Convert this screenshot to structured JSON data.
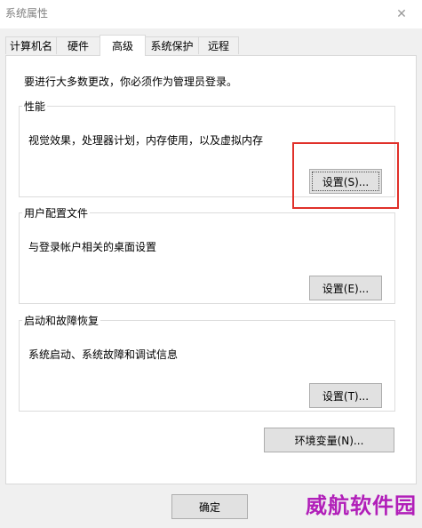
{
  "window": {
    "title": "系统属性",
    "close_glyph": "✕"
  },
  "tabs": [
    {
      "label": "计算机名"
    },
    {
      "label": "硬件"
    },
    {
      "label": "高级",
      "active": true
    },
    {
      "label": "系统保护"
    },
    {
      "label": "远程"
    }
  ],
  "admin_note": "要进行大多数更改，你必须作为管理员登录。",
  "performance": {
    "legend": "性能",
    "description": "视觉效果，处理器计划，内存使用，以及虚拟内存",
    "button": "设置(S)..."
  },
  "user_profiles": {
    "legend": "用户配置文件",
    "description": "与登录帐户相关的桌面设置",
    "button": "设置(E)..."
  },
  "startup_recovery": {
    "legend": "启动和故障恢复",
    "description": "系统启动、系统故障和调试信息",
    "button": "设置(T)..."
  },
  "env_button": "环境变量(N)...",
  "ok_button": "确定",
  "watermark": "威航软件园",
  "colors": {
    "highlight": "#e0302a",
    "watermark": "#b11fb9",
    "dialog_bg": "#f0f0f0"
  }
}
